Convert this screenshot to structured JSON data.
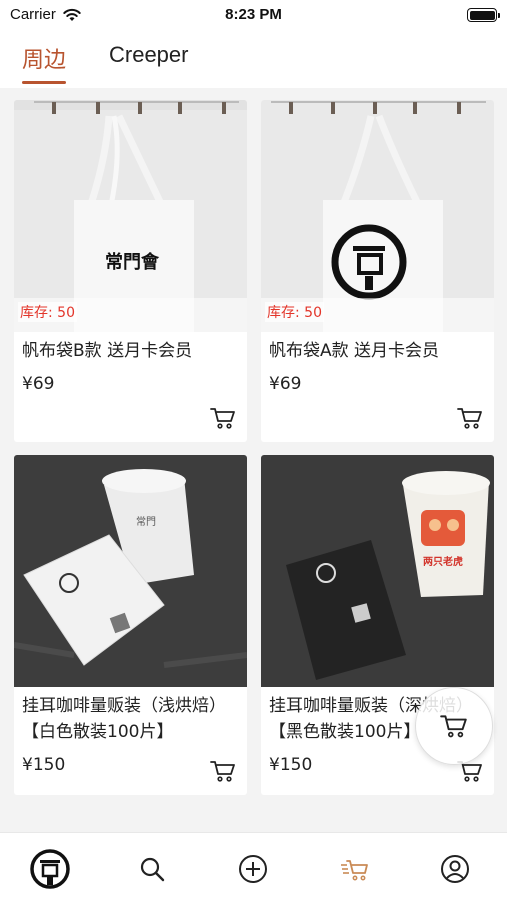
{
  "status_bar": {
    "carrier": "Carrier",
    "time": "8:23 PM"
  },
  "tabs": [
    {
      "label": "周边",
      "active": true
    },
    {
      "label": "Creeper",
      "active": false
    }
  ],
  "colors": {
    "accent": "#b8542f",
    "stock_red": "#e3352a",
    "background": "#f3f3f3"
  },
  "products": [
    {
      "title": "帆布袋B款 送月卡会员",
      "stock": "库存: 50",
      "price": "¥69"
    },
    {
      "title": "帆布袋A款 送月卡会员",
      "stock": "库存: 50",
      "price": "¥69"
    },
    {
      "title": "挂耳咖啡量贩装（浅烘焙）【白色散装100片】",
      "price": "¥150"
    },
    {
      "title": "挂耳咖啡量贩装（深烘焙）【黑色散装100片】",
      "price": "¥150"
    }
  ],
  "image_text": {
    "bag_b_logo": "常門會",
    "cup_badge": "两只老虎"
  },
  "bottom_nav": [
    {
      "icon": "brand-logo-icon"
    },
    {
      "icon": "search-icon"
    },
    {
      "icon": "add-circle-icon"
    },
    {
      "icon": "cart-icon",
      "active": true
    },
    {
      "icon": "profile-icon"
    }
  ]
}
